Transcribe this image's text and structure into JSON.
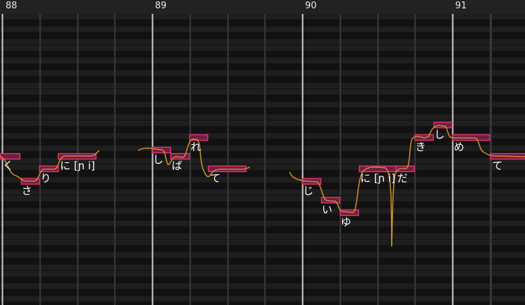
{
  "colors": {
    "background": "#141414",
    "row_dark": "#111111",
    "row_light": "#1e1e1e",
    "ruler": "#222222",
    "measure_line": "#d0d0d0",
    "beat_line": "#3a3a3a",
    "note_fill": "#6e1f45",
    "note_border": "#e0306e",
    "pitch_curve": "#c98a2a",
    "text": "#ffffff"
  },
  "measures": [
    {
      "label": "88"
    },
    {
      "label": "89"
    },
    {
      "label": "90"
    },
    {
      "label": "91"
    }
  ],
  "notes": [
    {
      "lyric": "く"
    },
    {
      "lyric": "さ"
    },
    {
      "lyric": "り"
    },
    {
      "lyric": "に [ɲ i]"
    },
    {
      "lyric": "し"
    },
    {
      "lyric": "ば"
    },
    {
      "lyric": "れ"
    },
    {
      "lyric": "て"
    },
    {
      "lyric": "じ"
    },
    {
      "lyric": "い"
    },
    {
      "lyric": "ゆ"
    },
    {
      "lyric": "に [ɲ i]"
    },
    {
      "lyric": "だ"
    },
    {
      "lyric": "き"
    },
    {
      "lyric": "し"
    },
    {
      "lyric": "め"
    },
    {
      "lyric": "て"
    }
  ]
}
